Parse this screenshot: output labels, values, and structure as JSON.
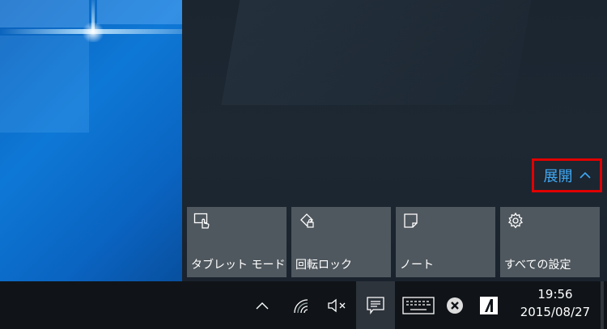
{
  "action_center": {
    "expand_label": "展開",
    "tiles": [
      {
        "label": "タブレット モード",
        "icon": "tablet-mode-icon"
      },
      {
        "label": "回転ロック",
        "icon": "rotation-lock-icon"
      },
      {
        "label": "ノート",
        "icon": "note-icon"
      },
      {
        "label": "すべての設定",
        "icon": "gear-icon"
      }
    ]
  },
  "taskbar": {
    "tray_icons": [
      "chevron-up-icon",
      "wifi-icon",
      "volume-muted-icon",
      "notification-icon",
      "keyboard-icon",
      "close-circle-icon",
      "adobe-icon"
    ],
    "clock_time": "19:56",
    "clock_date": "2015/08/27"
  },
  "colors": {
    "accent": "#3fa9f5",
    "highlight_border": "#e00000",
    "tile_bg": "#50585f",
    "taskbar_bg": "#101418"
  }
}
